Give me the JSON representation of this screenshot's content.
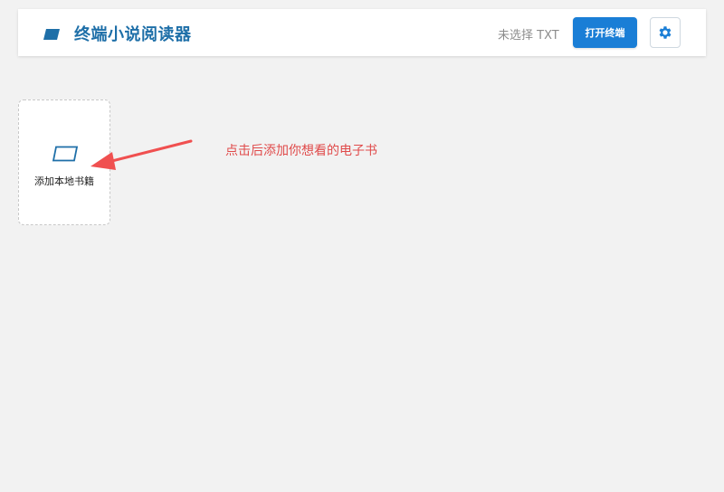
{
  "header": {
    "title": "终端小说阅读器",
    "logo_icon": "book-icon",
    "file_status": "未选择 TXT",
    "open_button_label": "打开终端",
    "settings_icon": "gear-icon"
  },
  "library": {
    "add_card_label": "添加本地书籍",
    "add_card_icon": "book-outline-icon"
  },
  "annotation": {
    "hint_text": "点击后添加你想看的电子书"
  },
  "colors": {
    "brand": "#1e6fa8",
    "button": "#1a7ed6",
    "annotation": "#e04b4b",
    "background": "#f2f2f2"
  }
}
